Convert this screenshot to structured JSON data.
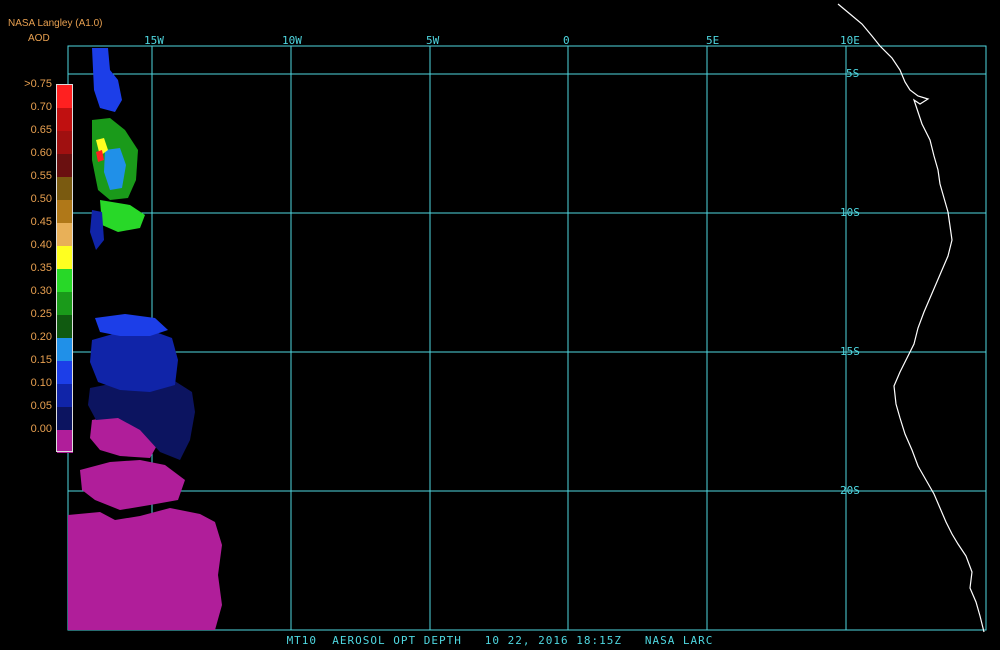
{
  "header": {
    "source": "NASA Langley (A1.0)",
    "variable": "AOD"
  },
  "legend": {
    "entries": [
      {
        "label": ">0.75",
        "color": "#ff2020"
      },
      {
        "label": "0.70",
        "color": "#c01010"
      },
      {
        "label": "0.65",
        "color": "#a01010"
      },
      {
        "label": "0.60",
        "color": "#6a1010"
      },
      {
        "label": "0.55",
        "color": "#7a5a10"
      },
      {
        "label": "0.50",
        "color": "#b07818"
      },
      {
        "label": "0.45",
        "color": "#e8b058"
      },
      {
        "label": "0.40",
        "color": "#ffff20"
      },
      {
        "label": "0.35",
        "color": "#28d828"
      },
      {
        "label": "0.30",
        "color": "#1a9a1a"
      },
      {
        "label": "0.25",
        "color": "#105a10"
      },
      {
        "label": "0.20",
        "color": "#2090e8"
      },
      {
        "label": "0.15",
        "color": "#1c3ee8"
      },
      {
        "label": "0.10",
        "color": "#1024a8"
      },
      {
        "label": "0.05",
        "color": "#0c1460"
      },
      {
        "label": "0.00",
        "color": "#b01e9a"
      }
    ]
  },
  "grid": {
    "longitudes": [
      "15W",
      "10W",
      "5W",
      "0",
      "5E",
      "10E"
    ],
    "latitudes": [
      "5S",
      "10S",
      "15S",
      "20S"
    ],
    "color": "#4fd7e0"
  },
  "coastline_color": "#ffffff",
  "footer": "MT10  AEROSOL OPT DEPTH   10 22, 2016 18:15Z   NASA LARC"
}
